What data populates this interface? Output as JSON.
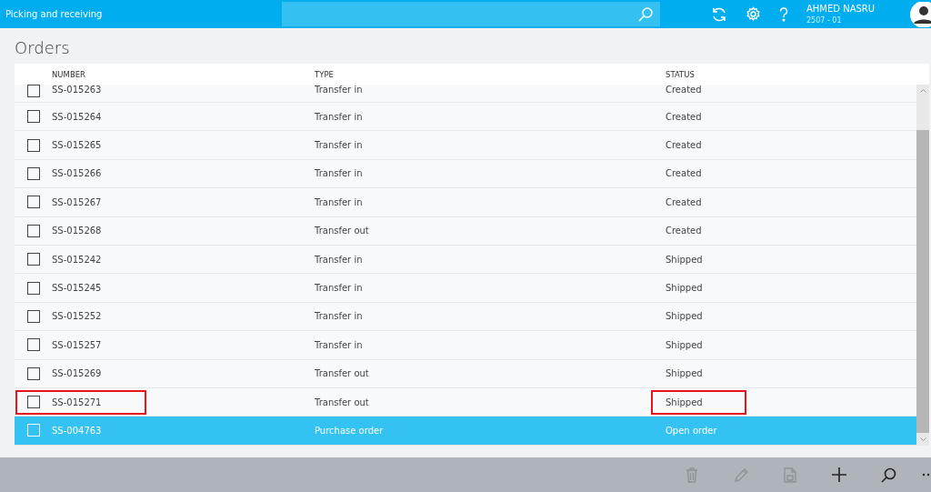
{
  "app_bar": {
    "title": "Picking and receiving",
    "user_name": "AHMED NASRU",
    "company": "2507 - 01"
  },
  "page_title": "Orders",
  "table": {
    "columns": [
      "NUMBER",
      "TYPE",
      "STATUS"
    ],
    "rows": [
      {
        "number": "SS-015263",
        "type": "Transfer in",
        "status": "Created",
        "selected": false,
        "annotated": false,
        "partial": true
      },
      {
        "number": "SS-015264",
        "type": "Transfer in",
        "status": "Created",
        "selected": false,
        "annotated": false
      },
      {
        "number": "SS-015265",
        "type": "Transfer in",
        "status": "Created",
        "selected": false,
        "annotated": false
      },
      {
        "number": "SS-015266",
        "type": "Transfer in",
        "status": "Created",
        "selected": false,
        "annotated": false
      },
      {
        "number": "SS-015267",
        "type": "Transfer in",
        "status": "Created",
        "selected": false,
        "annotated": false
      },
      {
        "number": "SS-015268",
        "type": "Transfer out",
        "status": "Created",
        "selected": false,
        "annotated": false
      },
      {
        "number": "SS-015242",
        "type": "Transfer in",
        "status": "Shipped",
        "selected": false,
        "annotated": false
      },
      {
        "number": "SS-015245",
        "type": "Transfer in",
        "status": "Shipped",
        "selected": false,
        "annotated": false
      },
      {
        "number": "SS-015252",
        "type": "Transfer in",
        "status": "Shipped",
        "selected": false,
        "annotated": false
      },
      {
        "number": "SS-015257",
        "type": "Transfer in",
        "status": "Shipped",
        "selected": false,
        "annotated": false
      },
      {
        "number": "SS-015269",
        "type": "Transfer out",
        "status": "Shipped",
        "selected": false,
        "annotated": false
      },
      {
        "number": "SS-015271",
        "type": "Transfer out",
        "status": "Shipped",
        "selected": false,
        "annotated": true
      },
      {
        "number": "SS-004763",
        "type": "Purchase order",
        "status": "Open order",
        "selected": true,
        "annotated": false
      }
    ]
  },
  "toolbar": [
    {
      "kind": "delete",
      "disabled": true
    },
    {
      "kind": "edit",
      "disabled": true
    },
    {
      "kind": "document",
      "disabled": true
    },
    {
      "kind": "add",
      "disabled": false
    },
    {
      "kind": "search",
      "disabled": false
    },
    {
      "kind": "more",
      "disabled": false
    }
  ]
}
